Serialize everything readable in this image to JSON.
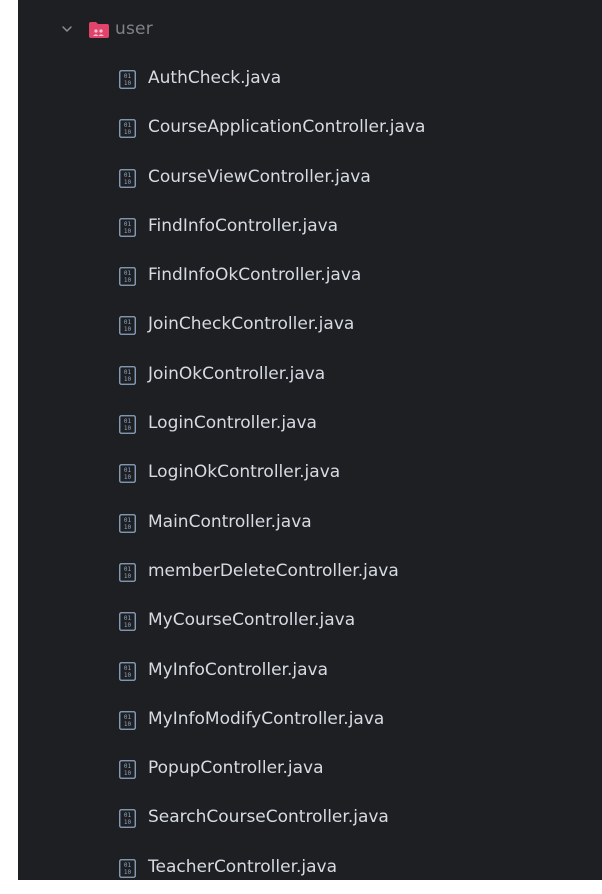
{
  "tree": {
    "folder": {
      "label": "user",
      "chevron_icon": "chevron-down-icon",
      "folder_icon": "package-folder-icon",
      "folder_color": "#e2436b"
    },
    "file_icon": "java-class-file-icon",
    "file_icon_color": "#8ea6c4",
    "files": [
      {
        "name": "AuthCheck.java"
      },
      {
        "name": "CourseApplicationController.java"
      },
      {
        "name": "CourseViewController.java"
      },
      {
        "name": "FindInfoController.java"
      },
      {
        "name": "FindInfoOkController.java"
      },
      {
        "name": "JoinCheckController.java"
      },
      {
        "name": "JoinOkController.java"
      },
      {
        "name": "LoginController.java"
      },
      {
        "name": "LoginOkController.java"
      },
      {
        "name": "MainController.java"
      },
      {
        "name": "memberDeleteController.java"
      },
      {
        "name": "MyCourseController.java"
      },
      {
        "name": "MyInfoController.java"
      },
      {
        "name": "MyInfoModifyController.java"
      },
      {
        "name": "PopupController.java"
      },
      {
        "name": "SearchCourseController.java"
      },
      {
        "name": "TeacherController.java"
      }
    ]
  }
}
